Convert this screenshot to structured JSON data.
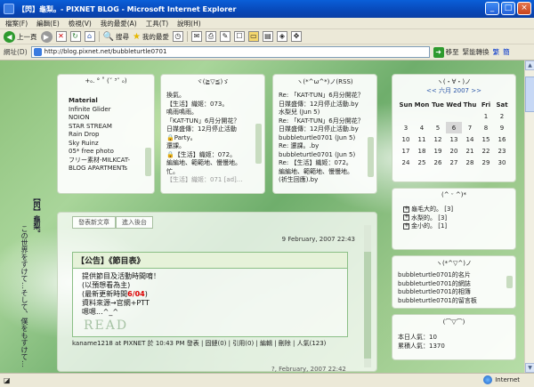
{
  "window": {
    "title": "【閃】龜梨。- PIXNET BLOG - Microsoft Internet Explorer",
    "min": "_",
    "max": "□",
    "close": "×"
  },
  "menu": [
    "檔案(F)",
    "編輯(E)",
    "檢視(V)",
    "我的最愛(A)",
    "工具(T)",
    "說明(H)"
  ],
  "toolbar": {
    "back": "上一頁",
    "back_arrow": "◀",
    "fwd_arrow": "▶",
    "search": "搜尋",
    "favorites": "我的最愛",
    "stop_icon": "stop-icon",
    "refresh_icon": "refresh-icon",
    "home_icon": "home-icon"
  },
  "address": {
    "label": "網址(D)",
    "url": "http://blog.pixnet.net/bubbleturtle0701",
    "go": "移至",
    "link1": "緊能轉換",
    "link2": "繁",
    "link3": "簡"
  },
  "side_text": {
    "title": "【閃】龜梨。",
    "subtitle": "この世界をすけて…そして、僕をもすけて…"
  },
  "panel_category": {
    "title": "+ₒ. ° ˚ (˘ ³˘ ₒ)",
    "items": [
      "Material",
      "Infinite Glider",
      "NOION",
      "STAR STREAM",
      "Rain Drop",
      "Sky Ruinz",
      "05* free photo",
      "フリー素材-MILKCAT-",
      "BLOG APARTMENTs"
    ]
  },
  "panel_recent": {
    "title": "ヾ(≧▽≦)ゞ",
    "items": [
      "換氣。",
      "【生活】織姬：073。",
      "鳴雨鳴雨。",
      "「KAT-TUN」6月分開花？",
      "日媒盛傳：12月停止活動",
      "Party。",
      "還課。",
      "【生活】織姬：072。",
      "編編地、範範地、慢慢地。",
      "忙。",
      "【生活】織姬：071 [ad]..."
    ]
  },
  "panel_comments": {
    "title": "ヽ(*^ω^*)ノ(RSS)",
    "items": [
      "Re: 「KAT-TUN」6月分開花？",
      "日媒盛傳：12月停止活動.by",
      "水梨兒 (Jun 5)",
      "Re: 「KAT-TUN」6月分開花？",
      "日媒盛傳：12月停止活動.by",
      "bubbleturtle0701 (Jun 5)",
      "Re: 還課。.by",
      "bubbleturtle0701 (Jun 5)",
      "Re: 【生活】織姬：072。",
      "編編地、範範地、慢慢地。",
      "(祈生回應).by"
    ]
  },
  "calendar": {
    "title": "ヽ(・∀・)ノ",
    "nav": "<< 六月 2007 >>",
    "weekdays": [
      "Sun",
      "Mon",
      "Tue",
      "Wed",
      "Thu",
      "Fri",
      "Sat"
    ],
    "rows": [
      [
        "",
        "",
        "",
        "",
        "",
        "1",
        "2"
      ],
      [
        "3",
        "4",
        "5",
        "6",
        "7",
        "8",
        "9"
      ],
      [
        "10",
        "11",
        "12",
        "13",
        "14",
        "15",
        "16"
      ],
      [
        "17",
        "18",
        "19",
        "20",
        "21",
        "22",
        "23"
      ],
      [
        "24",
        "25",
        "26",
        "27",
        "28",
        "29",
        "30"
      ]
    ],
    "today": "6"
  },
  "panel_links": {
    "title": "(^ ᵕ ^)*",
    "items": [
      "龜毛大的。 [3]",
      "水梨的。 [3]",
      "金小的。 [1]"
    ]
  },
  "panel_friends": {
    "title": "ヽ(*^▽^)ノ",
    "items": [
      "bubbleturtle0701的名片",
      "bubbleturtle0701的網誌",
      "bubbleturtle0701的相簿",
      "bubbleturtle0701的留言板"
    ]
  },
  "panel_counter": {
    "title": "(⌒▽⌒)",
    "today": "本日人氣：10",
    "total": "累積人氣：1370"
  },
  "post": {
    "links": [
      "發表新文章",
      "進入後台"
    ],
    "date": "9 February, 2007 22:43",
    "head": "【公告】《節目表》",
    "lines": [
      "提供節目及活動時間唷！",
      "(以預想看為主)",
      "(最新更新時間",
      "資料來源→官網+PTT",
      "嗯嗯...^_^"
    ],
    "update": "6/04",
    "update_close": ")",
    "logo": "READ",
    "footer": "kaname1218 at PIXNET 於 10:43 PM 發表 | 固鏈(0) | 引用(0) | 編輯 | 刪除 | 人氣(123)",
    "next": "?, February, 2007 22:42"
  },
  "status": {
    "zone": "Internet"
  }
}
